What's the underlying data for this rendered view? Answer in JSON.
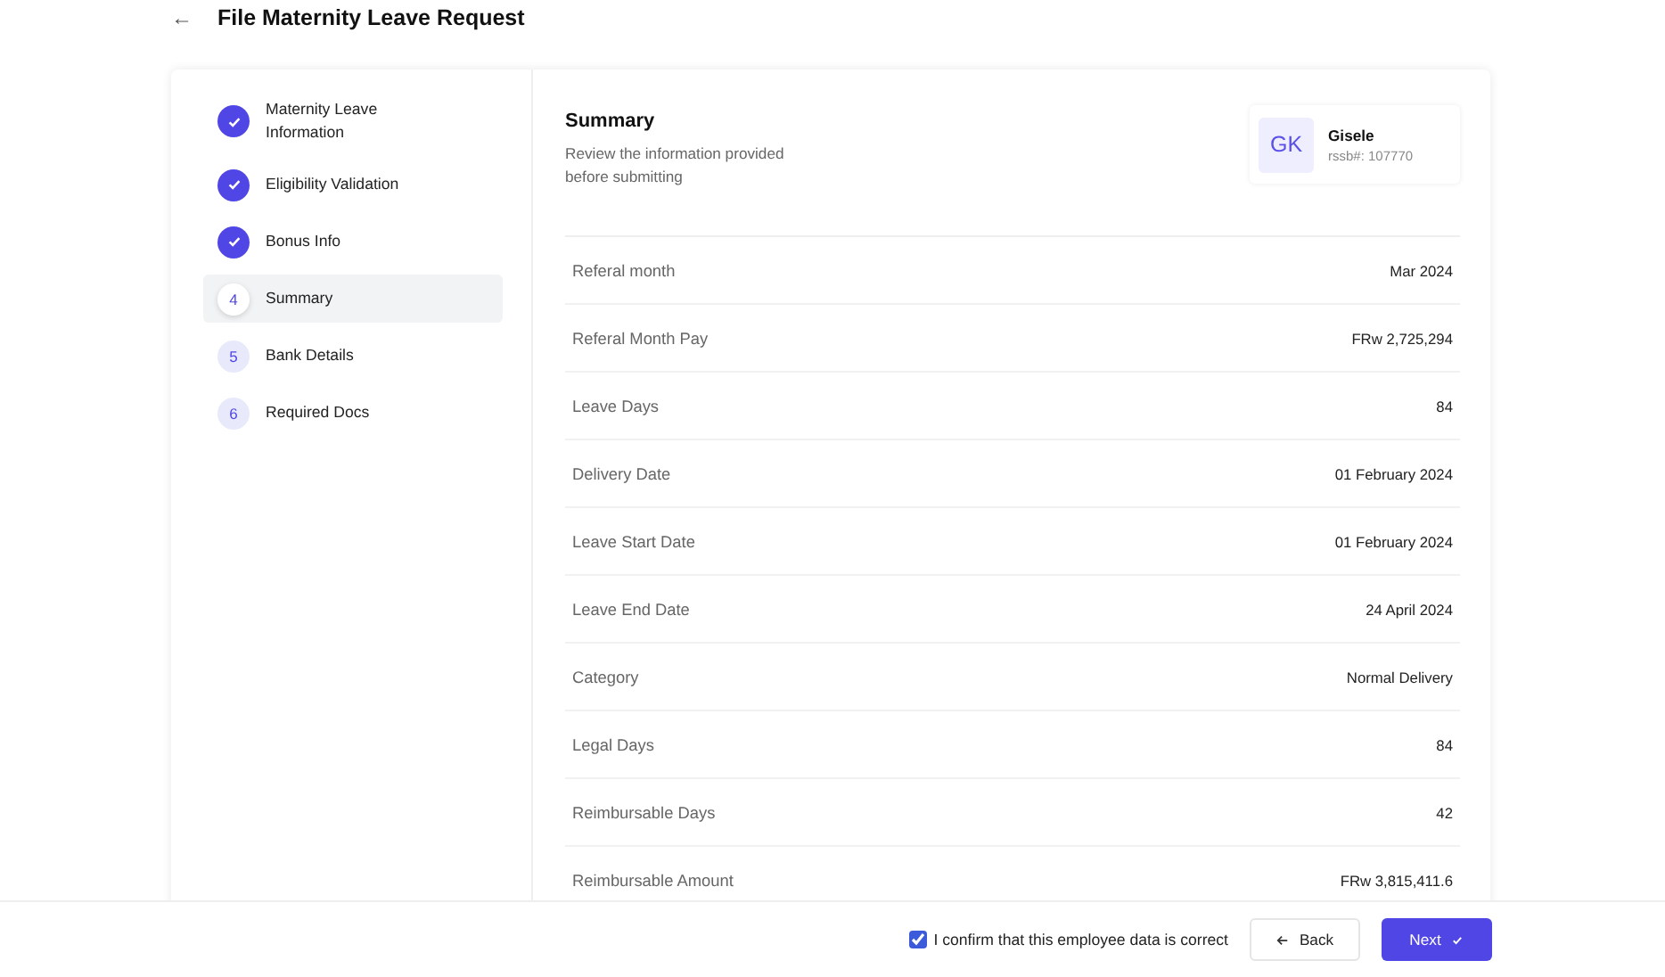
{
  "header": {
    "back_icon": "←",
    "title": "File Maternity Leave Request"
  },
  "steps": [
    {
      "label": "Maternity Leave Information",
      "completed": true,
      "selected": false
    },
    {
      "label": "Eligibility Validation",
      "completed": true,
      "selected": false
    },
    {
      "label": "Bonus Info",
      "completed": true,
      "selected": false
    },
    {
      "number": "4",
      "label": "Summary",
      "completed": false,
      "selected": true
    },
    {
      "number": "5",
      "label": "Bank Details",
      "completed": false,
      "selected": false
    },
    {
      "number": "6",
      "label": "Required Docs",
      "completed": false,
      "selected": false
    }
  ],
  "summary": {
    "title": "Summary",
    "subtitle": "Review the information provided before submitting"
  },
  "employee": {
    "initials": "GK",
    "name": "Gisele",
    "id": "rssb#: 107770"
  },
  "rows": [
    {
      "label": "Referal month",
      "value": "Mar 2024"
    },
    {
      "label": "Referal Month Pay",
      "value": "FRw 2,725,294"
    },
    {
      "label": "Leave Days",
      "value": "84"
    },
    {
      "label": "Delivery Date",
      "value": "01 February 2024"
    },
    {
      "label": "Leave Start Date",
      "value": "01 February 2024"
    },
    {
      "label": "Leave End Date",
      "value": "24 April 2024"
    },
    {
      "label": "Category",
      "value": "Normal Delivery"
    },
    {
      "label": "Legal Days",
      "value": "84"
    },
    {
      "label": "Reimbursable Days",
      "value": "42"
    },
    {
      "label": "Reimbursable Amount",
      "value": "FRw 3,815,411.6"
    }
  ],
  "footer": {
    "confirm": {
      "label": "I confirm that this employee data is correct",
      "checked": true
    },
    "back_button": "Back",
    "next_button": "Next"
  }
}
